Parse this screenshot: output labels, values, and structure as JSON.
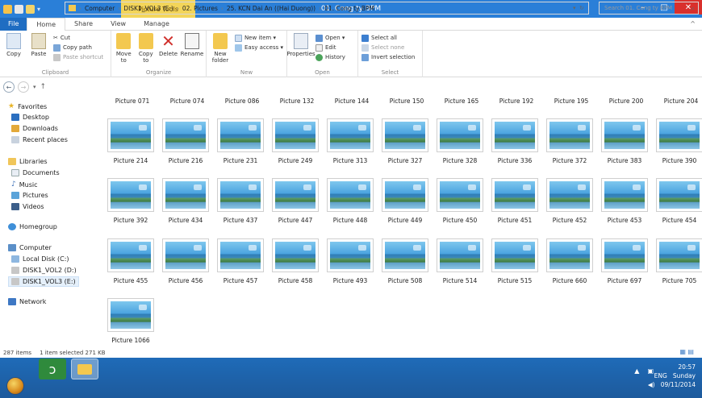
{
  "titlebar": {
    "context_tab": "Picture Tools",
    "title": "01. Cong ty BPM",
    "minimize": "–",
    "maximize": "□",
    "close": "✕"
  },
  "tabs": [
    {
      "label": "File"
    },
    {
      "label": "Home"
    },
    {
      "label": "Share"
    },
    {
      "label": "View"
    },
    {
      "label": "Manage"
    }
  ],
  "ribbon": {
    "clipboard": {
      "copy": "Copy",
      "paste": "Paste",
      "cut": "Cut",
      "copy_path": "Copy path",
      "paste_shortcut": "Paste shortcut",
      "label": "Clipboard"
    },
    "organize": {
      "move_to": "Move to",
      "copy_to": "Copy to",
      "delete": "Delete",
      "rename": "Rename",
      "label": "Organize"
    },
    "new": {
      "new_folder": "New folder",
      "new_item": "New item ▾",
      "easy_access": "Easy access ▾",
      "label": "New"
    },
    "open": {
      "properties": "Properties",
      "open": "Open ▾",
      "edit": "Edit",
      "history": "History",
      "label": "Open"
    },
    "select": {
      "select_all": "Select all",
      "select_none": "Select none",
      "invert_selection": "Invert selection",
      "label": "Select"
    }
  },
  "address": {
    "crumbs": [
      "Computer",
      "DISK1_VOL3 (E:)",
      "02. Pictures",
      "25. KCN Dai An ((Hai Duong))",
      "01. Cong ty BPM"
    ],
    "search_placeholder": "Search 01. Cong ty BPM"
  },
  "navpane": {
    "favorites": "Favorites",
    "desktop": "Desktop",
    "downloads": "Downloads",
    "recent_places": "Recent places",
    "libraries": "Libraries",
    "documents": "Documents",
    "music": "Music",
    "pictures": "Pictures",
    "videos": "Videos",
    "homegroup": "Homegroup",
    "computer": "Computer",
    "local_disk": "Local Disk (C:)",
    "disk1_vol2": "DISK1_VOL2 (D:)",
    "disk1_vol3": "DISK1_VOL3 (E:)",
    "network": "Network"
  },
  "files": {
    "top_row_labels": [
      "Picture 071",
      "Picture 074",
      "Picture 086",
      "Picture 132",
      "Picture 144",
      "Picture 150",
      "Picture 165",
      "Picture 192",
      "Picture 195",
      "Picture 200",
      "Picture 204"
    ],
    "rows": [
      [
        "Picture 214",
        "Picture 216",
        "Picture 231",
        "Picture 249",
        "Picture 313",
        "Picture 327",
        "Picture 328",
        "Picture 336",
        "Picture 372",
        "Picture 383",
        "Picture 390"
      ],
      [
        "Picture 392",
        "Picture 434",
        "Picture 437",
        "Picture 447",
        "Picture 448",
        "Picture 449",
        "Picture 450",
        "Picture 451",
        "Picture 452",
        "Picture 453",
        "Picture 454"
      ],
      [
        "Picture 455",
        "Picture 456",
        "Picture 457",
        "Picture 458",
        "Picture 493",
        "Picture 508",
        "Picture 514",
        "Picture 515",
        "Picture 660",
        "Picture 697",
        "Picture 705"
      ],
      [
        "Picture 1066"
      ]
    ]
  },
  "status": {
    "item_count": "287 items",
    "selection": "1 item selected  271 KB"
  },
  "taskbar": {
    "language": "ENG",
    "time": "20:57",
    "day": "Sunday",
    "date": "09/11/2014"
  }
}
